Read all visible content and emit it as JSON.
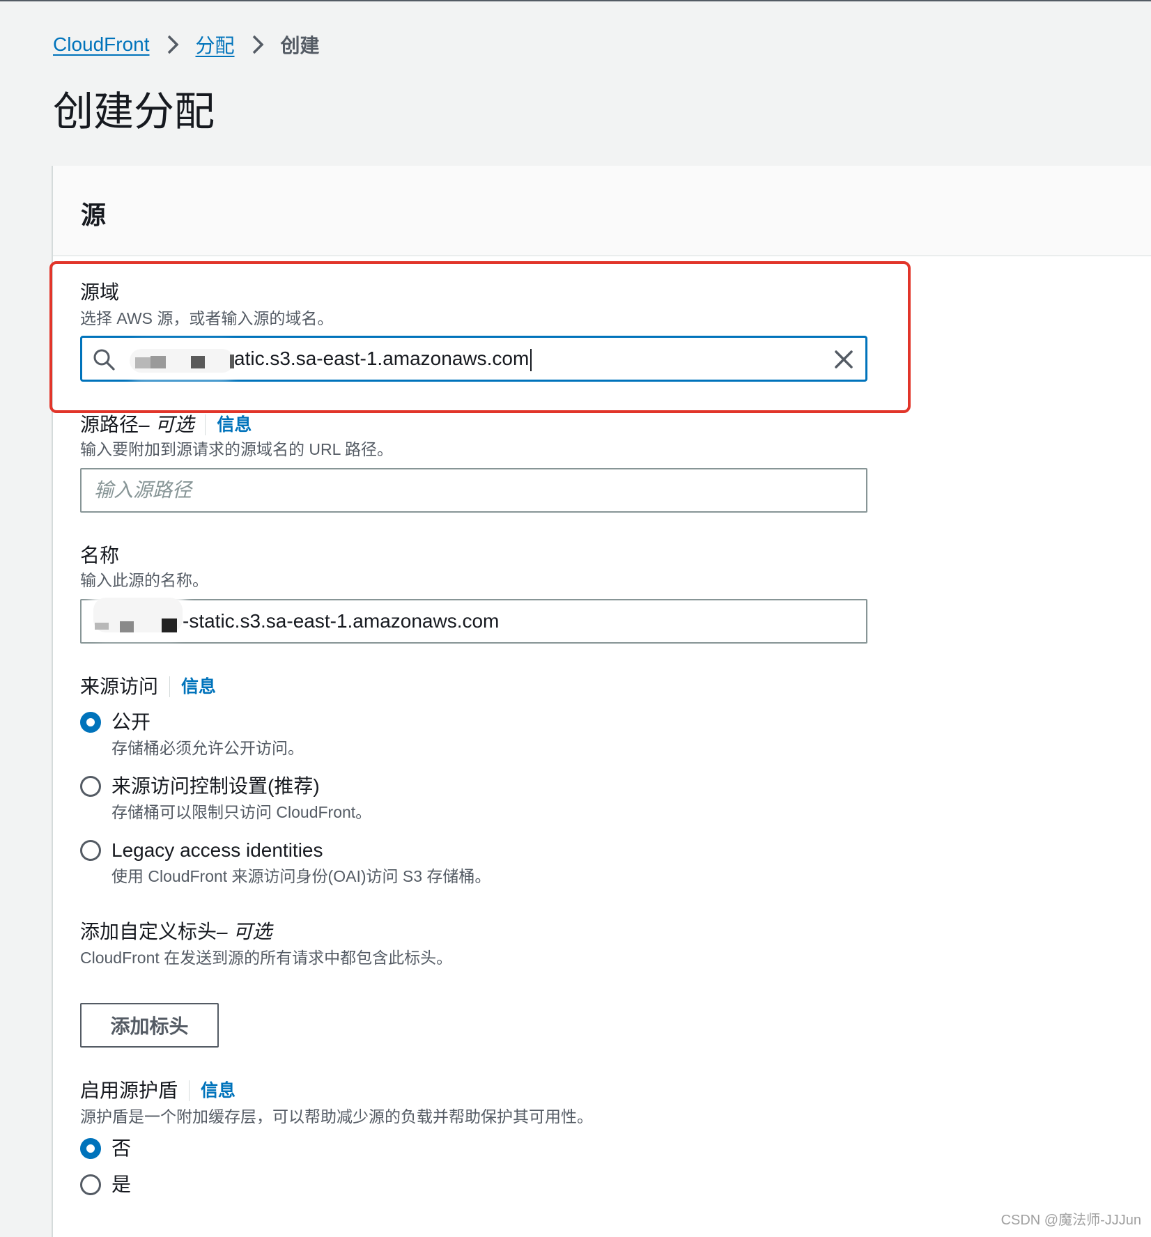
{
  "breadcrumb": {
    "items": [
      "CloudFront",
      "分配"
    ],
    "current": "创建"
  },
  "page_title": "创建分配",
  "section": {
    "title": "源"
  },
  "origin_domain": {
    "label": "源域",
    "description": "选择 AWS 源，或者输入源的域名。",
    "value_visible": "atic.s3.sa-east-1.amazonaws.com"
  },
  "origin_path": {
    "label": "源路径",
    "optional": " – 可选",
    "info": "信息",
    "description": "输入要附加到源请求的源域名的 URL 路径。",
    "placeholder": "输入源路径"
  },
  "name": {
    "label": "名称",
    "description": "输入此源的名称。",
    "value_visible": "-static.s3.sa-east-1.amazonaws.com"
  },
  "origin_access": {
    "label": "来源访问",
    "info": "信息",
    "options": [
      {
        "label": "公开",
        "description": "存储桶必须允许公开访问。",
        "checked": true
      },
      {
        "label": "来源访问控制设置(推荐)",
        "description": "存储桶可以限制只访问 CloudFront。",
        "checked": false
      },
      {
        "label": "Legacy access identities",
        "description": "使用 CloudFront 来源访问身份(OAI)访问 S3 存储桶。",
        "checked": false
      }
    ]
  },
  "custom_headers": {
    "label": "添加自定义标头",
    "optional": " – 可选",
    "description": "CloudFront 在发送到源的所有请求中都包含此标头。",
    "button": "添加标头"
  },
  "origin_shield": {
    "label": "启用源护盾",
    "info": "信息",
    "description": "源护盾是一个附加缓存层，可以帮助减少源的负载并帮助保护其可用性。",
    "options": [
      {
        "label": "否",
        "checked": true
      },
      {
        "label": "是",
        "checked": false
      }
    ]
  },
  "watermark": "CSDN @魔法师-JJJun",
  "colors": {
    "accent": "#0073bb",
    "highlight": "#e1352a",
    "text": "#16191f",
    "muted": "#545b64"
  }
}
